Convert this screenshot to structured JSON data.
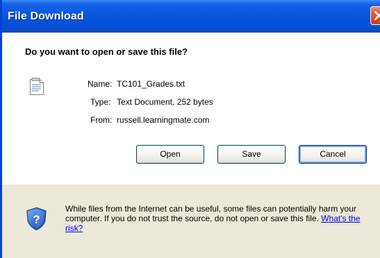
{
  "window": {
    "title": "File Download"
  },
  "dialog": {
    "question": "Do you want to open or save this file?",
    "file_icon": "text-file-icon",
    "fields": {
      "name_label": "Name:",
      "name_value": "TC101_Grades.txt",
      "type_label": "Type:",
      "type_value": "Text Document, 252 bytes",
      "from_label": "From:",
      "from_value": "russell.learningmate.com"
    },
    "buttons": {
      "open": "Open",
      "save": "Save",
      "cancel": "Cancel"
    }
  },
  "warning": {
    "icon": "shield-question-icon",
    "text": "While files from the Internet can be useful, some files can potentially harm your computer. If you do not trust the source, do not open or save this file.",
    "link": "What's the risk?"
  },
  "colors": {
    "titlebar": "#0a58e2",
    "link": "#0000ff",
    "close_button": "#d9573a"
  }
}
